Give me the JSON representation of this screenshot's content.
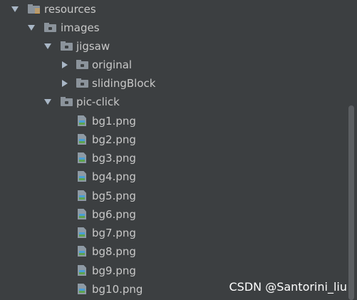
{
  "tree": {
    "resources": "resources",
    "images": "images",
    "jigsaw": "jigsaw",
    "original": "original",
    "slidingBlock": "slidingBlock",
    "pic_click": "pic-click",
    "files": [
      "bg1.png",
      "bg2.png",
      "bg3.png",
      "bg4.png",
      "bg5.png",
      "bg6.png",
      "bg7.png",
      "bg8.png",
      "bg9.png",
      "bg10.png"
    ]
  },
  "watermark": "CSDN @Santorini_liu",
  "icons": {
    "folder": "folder-icon",
    "resources_folder": "resources-folder-icon",
    "image_file": "png-file-icon",
    "expanded": "chevron-down-icon",
    "collapsed": "chevron-right-icon"
  },
  "colors": {
    "background": "#3c3f41",
    "text": "#c8c8c8",
    "arrow": "#a9b7c6",
    "folder": "#8b939b",
    "resource_marker": "#e8a33d"
  }
}
